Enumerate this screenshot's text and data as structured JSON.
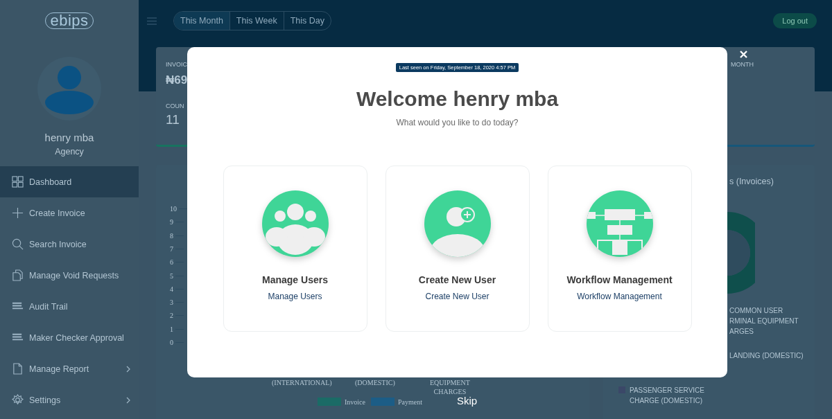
{
  "sidebar": {
    "logo": "ebips",
    "user": {
      "name": "henry mba",
      "role": "Agency"
    },
    "items": [
      {
        "label": "Dashboard",
        "selected": true,
        "expandable": false
      },
      {
        "label": "Create Invoice",
        "selected": false,
        "expandable": false
      },
      {
        "label": "Search Invoice",
        "selected": false,
        "expandable": false
      },
      {
        "label": "Manage Void Requests",
        "selected": false,
        "expandable": false
      },
      {
        "label": "Audit Trail",
        "selected": false,
        "expandable": false
      },
      {
        "label": "Maker Checker Approval",
        "selected": false,
        "expandable": false
      },
      {
        "label": "Manage Report",
        "selected": false,
        "expandable": true
      },
      {
        "label": "Settings",
        "selected": false,
        "expandable": true
      }
    ]
  },
  "header": {
    "period_tabs": [
      {
        "label": "This Month",
        "selected": true
      },
      {
        "label": "This Week",
        "selected": false
      },
      {
        "label": "This Day",
        "selected": false
      }
    ],
    "logout": "Log out"
  },
  "stats": {
    "card_1": {
      "label": "INVOIC",
      "amount": "₦69",
      "count_label": "COUN",
      "count": "11"
    },
    "card_3": {
      "label": "MONTH"
    }
  },
  "bar_panel": {
    "y_ticks": [
      "10",
      "9",
      "8",
      "7",
      "6",
      "5",
      "4",
      "3",
      "2",
      "1",
      "0"
    ],
    "categories": [
      {
        "lines": [
          "(INTERNATIONAL)"
        ]
      },
      {
        "lines": [
          "(DOMESTIC)"
        ]
      },
      {
        "lines": [
          "EQUIPMENT",
          "CHARGES"
        ]
      }
    ],
    "legend": [
      {
        "label": "Invoice",
        "color": "#1b6b66"
      },
      {
        "label": "Payment",
        "color": "#1c5d86"
      }
    ]
  },
  "donut_panel": {
    "title": "s (Invoices)",
    "legend": [
      {
        "lines": [
          "COMMON USER",
          "RMINAL EQUIPMENT",
          "ARGES"
        ]
      },
      {
        "lines": [
          "LANDING (DOMESTIC)"
        ]
      },
      {
        "lines": [
          "PASSENGER SERVICE",
          "CHARGE (DOMESTIC)"
        ],
        "color": "#3b4868"
      }
    ]
  },
  "modal": {
    "last_seen": "Last seen on Friday, September 18, 2020 4:57 PM",
    "title": "Welcome henry mba",
    "subtitle": "What would you like to do today?",
    "cards": [
      {
        "title": "Manage Users",
        "link": "Manage Users"
      },
      {
        "title": "Create New User",
        "link": "Create New User"
      },
      {
        "title": "Workflow Management",
        "link": "Workflow Management"
      }
    ],
    "skip": "Skip"
  }
}
